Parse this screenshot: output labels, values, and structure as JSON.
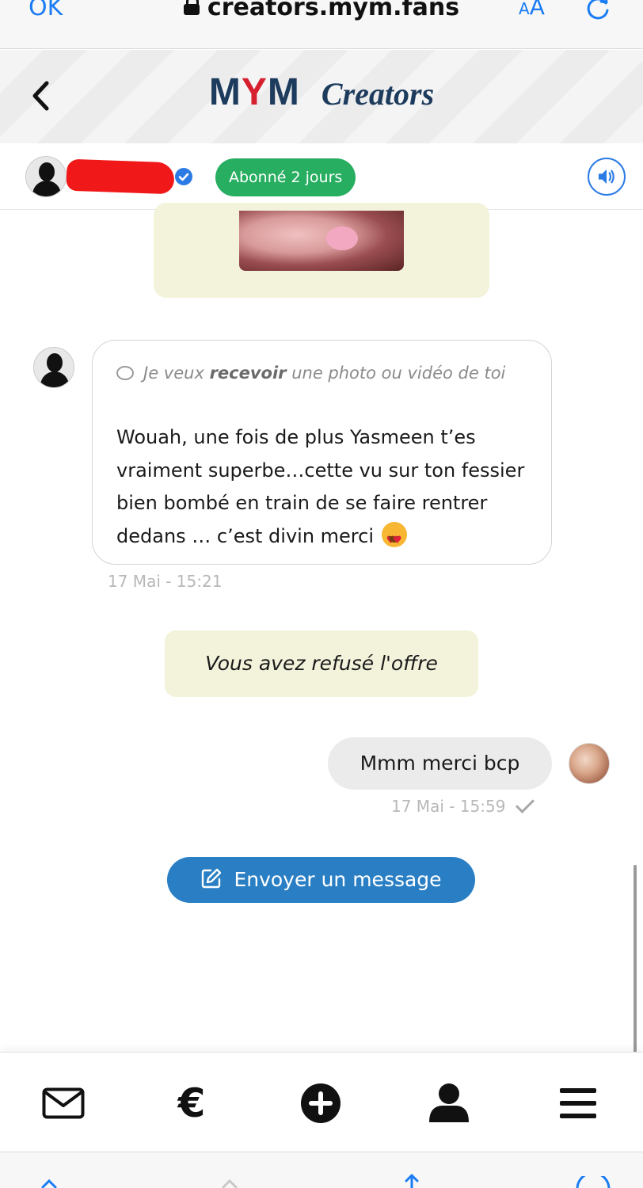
{
  "browser": {
    "done_label": "OK",
    "url": "creators.mym.fans",
    "text_size_small": "A",
    "text_size_large": "A"
  },
  "header": {
    "brand_m1": "M",
    "brand_y": "Y",
    "brand_m2": "M",
    "brand_suffix": "Creators"
  },
  "profile": {
    "badge": "Abonné 2 jours"
  },
  "messages": {
    "incoming": {
      "quote_prefix": "Je veux ",
      "quote_bold": "recevoir",
      "quote_suffix": " une photo ou vidéo de toi",
      "text": "Wouah, une fois de plus Yasmeen t’es vraiment superbe…cette vu sur ton fessier bien bombé en train de se faire rentrer dedans … c’est divin merci ",
      "timestamp": "17 Mai - 15:21"
    },
    "offer_status": "Vous avez refusé l'offre",
    "outgoing": {
      "text": "Mmm merci bcp",
      "timestamp": "17 Mai - 15:59"
    }
  },
  "actions": {
    "send_message_label": "Envoyer un message"
  },
  "bottom_nav": {
    "items": [
      "mail-icon",
      "euro-icon",
      "plus-icon",
      "user-icon",
      "menu-icon"
    ],
    "euro_glyph": "€"
  },
  "colors": {
    "accent_blue": "#2a7fc4",
    "badge_green": "#27ae60",
    "brand_navy": "#1d3b5c",
    "brand_red": "#d62030",
    "offer_bg": "#f3f3dc"
  }
}
